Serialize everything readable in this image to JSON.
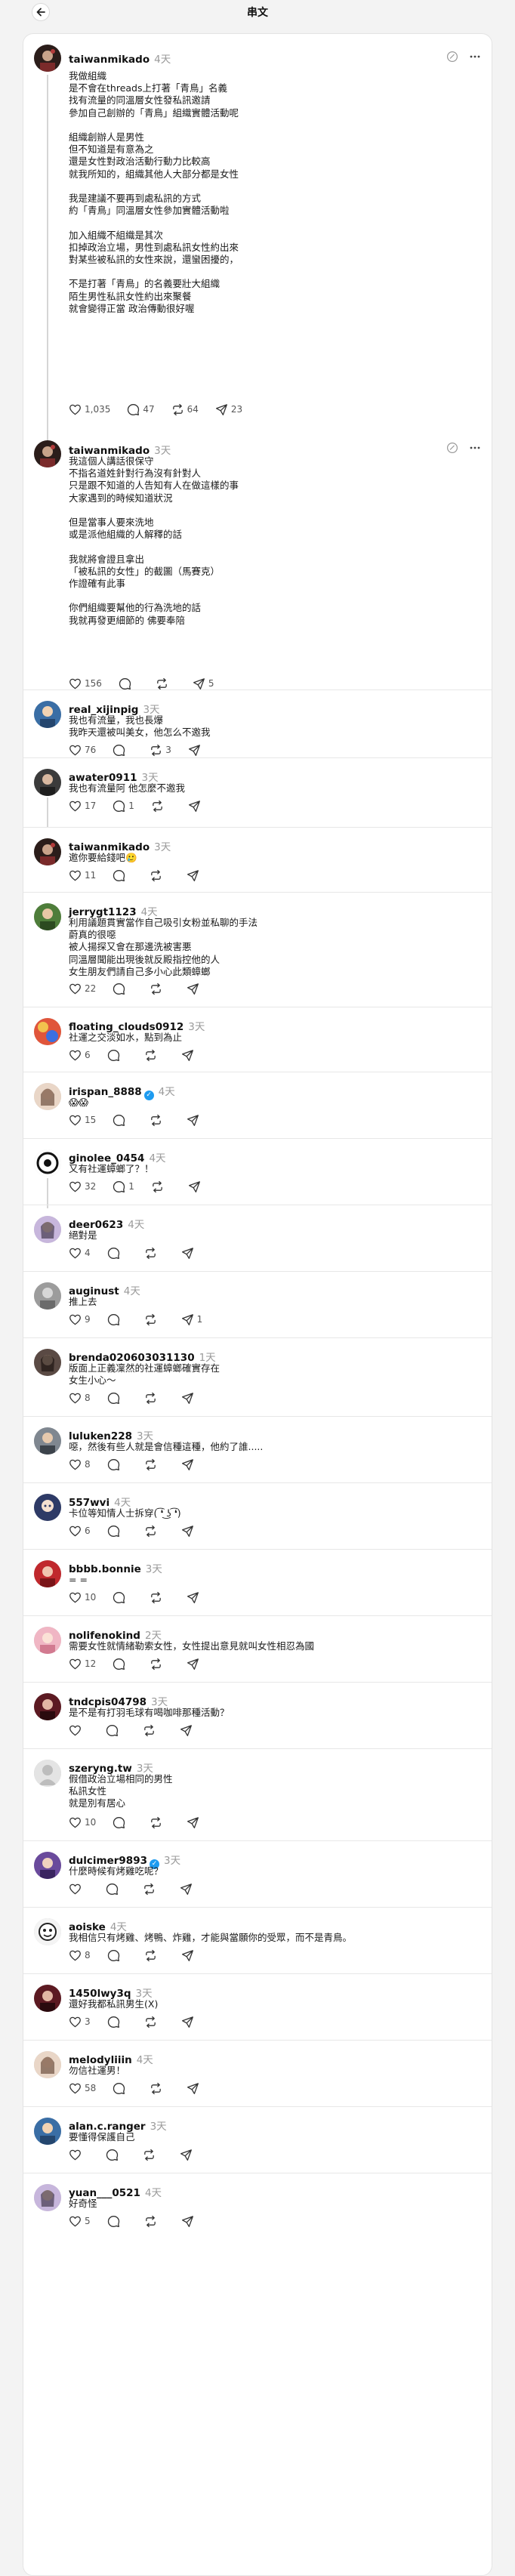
{
  "header": {
    "title": "串文"
  },
  "posts": [
    {
      "username": "taiwanmikado",
      "time": "4天",
      "verified": false,
      "text": "我做組織\n是不會在threads上打著「青鳥」名義\n找有流量的同溫層女性發私訊邀請\n參加自己創辦的「青鳥」組織實體活動呢\n\n組織創辦人是男性\n但不知道是有意為之\n還是女性對政治活動行動力比較高\n就我所知的，組織其他人大部分都是女性\n\n我是建議不要再到處私訊的方式\n約「青鳥」同溫層女性參加實體活動啦\n\n加入組織不組織是其次\n扣掉政治立場，男性到處私訊女性約出來\n對某些被私訊的女性來說，還蠻困擾的，\n\n不是打著「青鳥」的名義要壯大組織\n陌生男性私訊女性約出來聚餐\n就會變得正當 政治傳動很好喔",
      "likes": "1,035",
      "comments": "47",
      "reposts": "64",
      "shares": "23",
      "avatar": "thread-owner"
    },
    {
      "username": "taiwanmikado",
      "time": "3天",
      "verified": false,
      "text": "我這個人講話很保守\n不指名道姓針對行為沒有針對人\n只是跟不知道的人告知有人在做這樣的事\n大家遇到的時候知道狀況\n\n但是當事人要來洗地\n或是派他組織的人解釋的話\n\n我就將會證且拿出\n「被私訊的女性」的截圖（馬賽克）\n作證確有此事\n\n你們組織要幫他的行為洗地的話\n我就再發更細節的 佛要奉陪",
      "likes": "156",
      "comments": "",
      "reposts": "",
      "shares": "5",
      "avatar": "thread-owner"
    },
    {
      "username": "real_xijinpig",
      "time": "3天",
      "verified": false,
      "text": "我也有流量，我也長爆\n我昨天還被叫美女，他怎么不邀我",
      "likes": "76",
      "comments": "",
      "reposts": "3",
      "shares": "",
      "avatar": "blue"
    },
    {
      "username": "awater0911",
      "time": "3天",
      "verified": false,
      "text": "我也有流量阿 他怎麼不邀我",
      "likes": "17",
      "comments": "1",
      "reposts": "",
      "shares": "",
      "avatar": "dark-man"
    },
    {
      "username": "taiwanmikado",
      "time": "3天",
      "verified": false,
      "text": "邀你要給錢吧🥲",
      "likes": "11",
      "comments": "",
      "reposts": "",
      "shares": "",
      "avatar": "thread-owner"
    },
    {
      "username": "jerrygt1123",
      "time": "4天",
      "verified": false,
      "text": "利用議題貫實當作自己吸引女粉並私聊的手法\n蔚真的很噁\n被人揚探又會在那邊洗被害悪\n同溫層聞能出現後就反殿指控他的人\n女生朋友們請自己多小心此類蟑螂",
      "likes": "22",
      "comments": "",
      "reposts": "",
      "shares": "",
      "avatar": "green"
    },
    {
      "username": "floating_clouds0912",
      "time": "3天",
      "verified": false,
      "text": "社運之交淡如水，點到為止",
      "likes": "6",
      "comments": "",
      "reposts": "",
      "shares": "",
      "avatar": "colorful"
    },
    {
      "username": "irispan_8888",
      "time": "4天",
      "verified": true,
      "text": "😱😱",
      "likes": "15",
      "comments": "",
      "reposts": "",
      "shares": "",
      "avatar": "woman-light"
    },
    {
      "username": "ginolee_0454",
      "time": "4天",
      "verified": false,
      "text": "又有社運蟑螂了？！",
      "likes": "32",
      "comments": "1",
      "reposts": "",
      "shares": "",
      "avatar": "circle-logo"
    },
    {
      "username": "deer0623",
      "time": "4天",
      "verified": false,
      "text": "絕對是",
      "likes": "4",
      "comments": "",
      "reposts": "",
      "shares": "",
      "avatar": "woman-purple"
    },
    {
      "username": "auginust",
      "time": "4天",
      "verified": false,
      "text": "推上去",
      "likes": "9",
      "comments": "",
      "reposts": "",
      "shares": "1",
      "avatar": "gray"
    },
    {
      "username": "brenda020603031130",
      "time": "1天",
      "verified": false,
      "text": "版面上正義凜然的社運蟑螂確實存在\n女生小心～",
      "likes": "8",
      "comments": "",
      "reposts": "",
      "shares": "",
      "avatar": "woman-dark"
    },
    {
      "username": "luluken228",
      "time": "3天",
      "verified": false,
      "text": "噁，然後有些人就是會信種這種，他約了誰.....",
      "likes": "8",
      "comments": "",
      "reposts": "",
      "shares": "",
      "avatar": "man-gray"
    },
    {
      "username": "557wvi",
      "time": "4天",
      "verified": false,
      "text": "卡位等知情人士拆穿( ͡❛ ͜ʖ ͡❛)",
      "likes": "6",
      "comments": "",
      "reposts": "",
      "shares": "",
      "avatar": "anime"
    },
    {
      "username": "bbbb.bonnie",
      "time": "3天",
      "verified": false,
      "text": "= =",
      "likes": "10",
      "comments": "",
      "reposts": "",
      "shares": "",
      "avatar": "red"
    },
    {
      "username": "nolifenokind",
      "time": "2天",
      "verified": false,
      "text": "需要女性就情緒勒索女性，女性提出意見就叫女性相忍為國",
      "likes": "12",
      "comments": "",
      "reposts": "",
      "shares": "",
      "avatar": "pink"
    },
    {
      "username": "tndcpis04798",
      "time": "3天",
      "verified": false,
      "text": "是不是有打羽毛球有喝咖啡那種活動？",
      "likes": "",
      "comments": "",
      "reposts": "",
      "shares": "",
      "avatar": "dark-red"
    },
    {
      "username": "szeryng.tw",
      "time": "3天",
      "verified": false,
      "text": "假借政治立場相同的男性\n私訊女性\n就是別有居心",
      "likes": "10",
      "comments": "",
      "reposts": "",
      "shares": "",
      "avatar": "default"
    },
    {
      "username": "dulcimer9893",
      "time": "3天",
      "verified": true,
      "text": "什麼時候有烤雞吃呢？",
      "likes": "",
      "comments": "",
      "reposts": "",
      "shares": "",
      "avatar": "purple"
    },
    {
      "username": "aoiske",
      "time": "4天",
      "verified": false,
      "text": "我相信只有烤雞、烤鴨、炸雞，才能與當願你的受眾，而不是青鳥。",
      "likes": "8",
      "comments": "",
      "reposts": "",
      "shares": "",
      "avatar": "cartoon"
    },
    {
      "username": "1450lwy3q",
      "time": "3天",
      "verified": false,
      "text": "還好我都私訊男生(X)",
      "likes": "3",
      "comments": "",
      "reposts": "",
      "shares": "",
      "avatar": "dark-red"
    },
    {
      "username": "melodyliiin",
      "time": "4天",
      "verified": false,
      "text": "勿信社運男！",
      "likes": "58",
      "comments": "",
      "reposts": "",
      "shares": "",
      "avatar": "woman-light"
    },
    {
      "username": "alan.c.ranger",
      "time": "3天",
      "verified": false,
      "text": "要懂得保護自己",
      "likes": "",
      "comments": "",
      "reposts": "",
      "shares": "",
      "avatar": "blue"
    },
    {
      "username": "yuan___0521",
      "time": "4天",
      "verified": false,
      "text": "好奇怪",
      "likes": "5",
      "comments": "",
      "reposts": "",
      "shares": "",
      "avatar": "woman-purple"
    }
  ]
}
